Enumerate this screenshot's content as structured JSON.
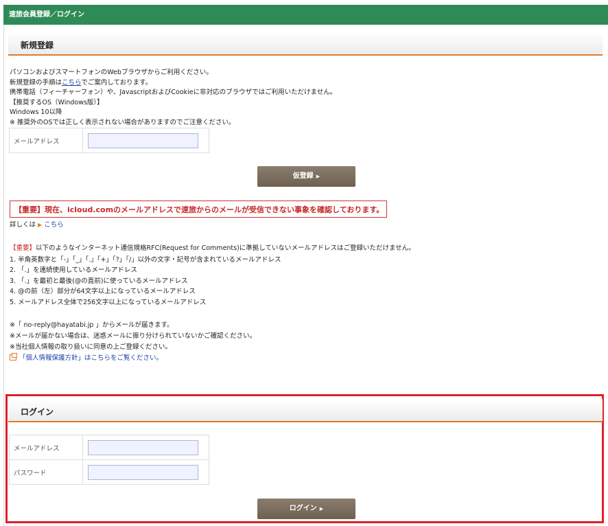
{
  "header": {
    "title": "速旅会員登録／ログイン"
  },
  "register": {
    "title": "新規登録",
    "lines": [
      "パソコンおよびスマートフォンのWebブラウザからご利用ください。",
      "新規登録の手順は",
      "こちら",
      "でご案内しております。",
      "携帯電話（フィーチャーフォン）や、JavascriptおよびCookieに非対応のブラウザではご利用いただけません。",
      "【推奨するOS（Windows版）】",
      "Windows 10以降",
      "※ 推奨外のOSでは正しく表示されない場合がありますのでご注意ください。"
    ],
    "email_label": "メールアドレス",
    "email_value": "",
    "submit_label": "仮登録"
  },
  "notice": {
    "text": "【重要】現在、icloud.comのメールアドレスで速旅からのメールが受信できない事象を確認しております。",
    "detail_prefix": "詳しくは",
    "detail_link": "こちら"
  },
  "rules": {
    "tag": "【重要】",
    "intro": "以下のようなインターネット通信規格RFC(Request for Comments)に準拠していないメールアドレスはご登録いただけません。",
    "items": [
      "1. 半角英数字と「-」「_」「.」「+」「?」「/」以外の文字・記号が含まれているメールアドレス",
      "2. 「.」を連続使用しているメールアドレス",
      "3. 「.」を最初と最後(@の直前)に使っているメールアドレス",
      "4. @の前（左）部分が64文字以上になっているメールアドレス",
      "5. メールアドレス全体で256文字以上になっているメールアドレス"
    ]
  },
  "notes": [
    "※「 no-reply@hayatabi.jp 」からメールが届きます。",
    "※メールが届かない場合は、迷惑メールに振り分けられていないかご確認ください。",
    "※当社個人情報の取り扱いに同意の上ご登録ください。"
  ],
  "privacy_link": "「個人情報保護方針」はこちらをご覧ください。",
  "login": {
    "title": "ログイン",
    "email_label": "メールアドレス",
    "password_label": "パスワード",
    "email_value": "",
    "password_value": "",
    "submit_label": "ログイン"
  },
  "colors": {
    "header_bg": "#2e8b57",
    "accent": "#e07a2a",
    "highlight_border": "#e0202a",
    "button": "#7a6d5e"
  }
}
